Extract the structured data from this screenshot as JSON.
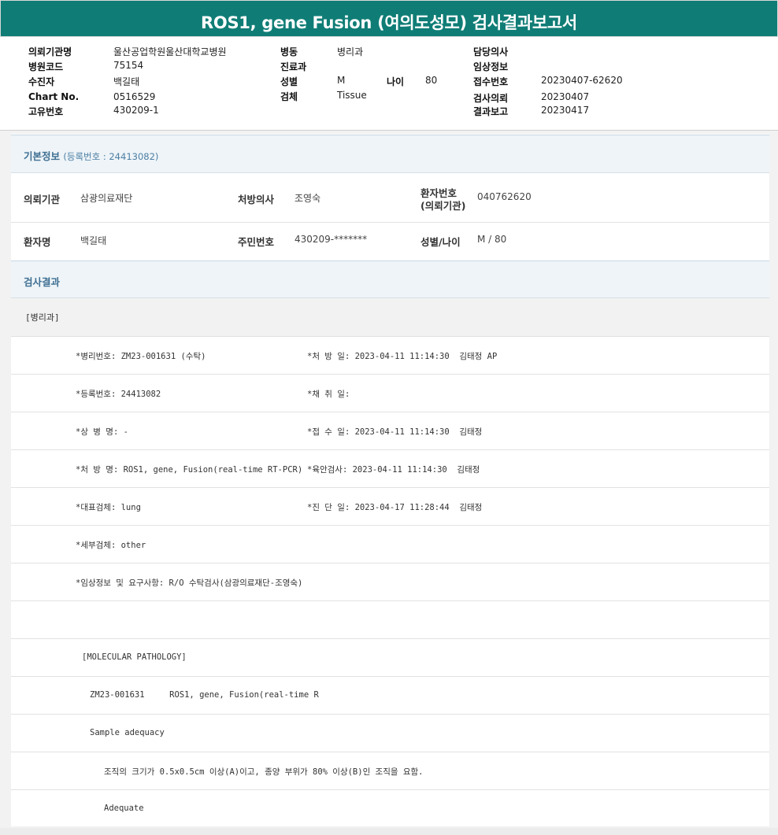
{
  "title": "ROS1, gene Fusion (여의도성모) 검사결과보고서",
  "header": {
    "col1": [
      {
        "label": "의뢰기관명",
        "value": "울산공업학원울산대학교병원"
      },
      {
        "label": "병원코드",
        "value": "75154"
      },
      {
        "label": "수진자",
        "value": "백길태"
      },
      {
        "label": "Chart No.",
        "value": "0516529"
      },
      {
        "label": "고유번호",
        "value": "430209-1"
      }
    ],
    "col2": [
      {
        "label": "병동",
        "value": "병리과"
      },
      {
        "label": "진료과",
        "value": ""
      },
      {
        "label": "성별",
        "value": "M"
      },
      {
        "label": "검체",
        "value": "Tissue"
      }
    ],
    "age": {
      "label": "나이",
      "value": "80"
    },
    "col3": [
      {
        "label": "담당의사",
        "value": ""
      },
      {
        "label": "임상정보",
        "value": ""
      },
      {
        "label": "접수번호",
        "value": "20230407-62620"
      },
      {
        "label": "검사의뢰",
        "value": "20230407"
      },
      {
        "label": "결과보고",
        "value": "20230417"
      }
    ]
  },
  "basic": {
    "title": "기본정보",
    "reg": "(등록번호 : 24413082)",
    "row1": {
      "inst_label": "의뢰기관",
      "inst_value": "삼광의료재단",
      "doctor_label": "처방의사",
      "doctor_value": "조영숙",
      "pid_label_1": "환자번호",
      "pid_label_2": "(의뢰기관)",
      "pid_value": "040762620"
    },
    "row2": {
      "name_label": "환자명",
      "name_value": "백길태",
      "rrn_label": "주민번호",
      "rrn_value": "430209-*******",
      "sexage_label": "성별/나이",
      "sexage_value": "M / 80"
    }
  },
  "results": {
    "title": "검사결과",
    "dept": "[병리과]",
    "rows": [
      {
        "left": "*병리번호: ZM23-001631 (수탁)",
        "right": "*처 방 일: 2023-04-11 11:14:30  김태정 AP"
      },
      {
        "left": "*등록번호: 24413082",
        "right": "*채 취 일:"
      },
      {
        "left": "*상 병 명: -",
        "right": "*접 수 일: 2023-04-11 11:14:30  김태정"
      },
      {
        "left": "*처 방 명: ROS1, gene, Fusion(real-time RT-PCR)",
        "right": "*육안검사: 2023-04-11 11:14:30  김태정"
      },
      {
        "left": "*대표검체: lung",
        "right": "*진 단 일: 2023-04-17 11:28:44  김태정"
      },
      {
        "left": "*세부검체: other",
        "right": ""
      },
      {
        "left": "*임상정보 및 요구사항: R/O 수탁검사(삼광의료재단-조영숙)",
        "right": ""
      }
    ],
    "mol_title": "[MOLECULAR PATHOLOGY]",
    "mol_line": "ZM23-001631     ROS1, gene, Fusion(real-time R",
    "adequacy": "Sample adequacy",
    "criteria": "조직의 크기가 0.5x0.5cm 이상(A)이고, 종양 부위가 80% 이상(B)인 조직을 요함.",
    "adequate": "Adequate"
  }
}
